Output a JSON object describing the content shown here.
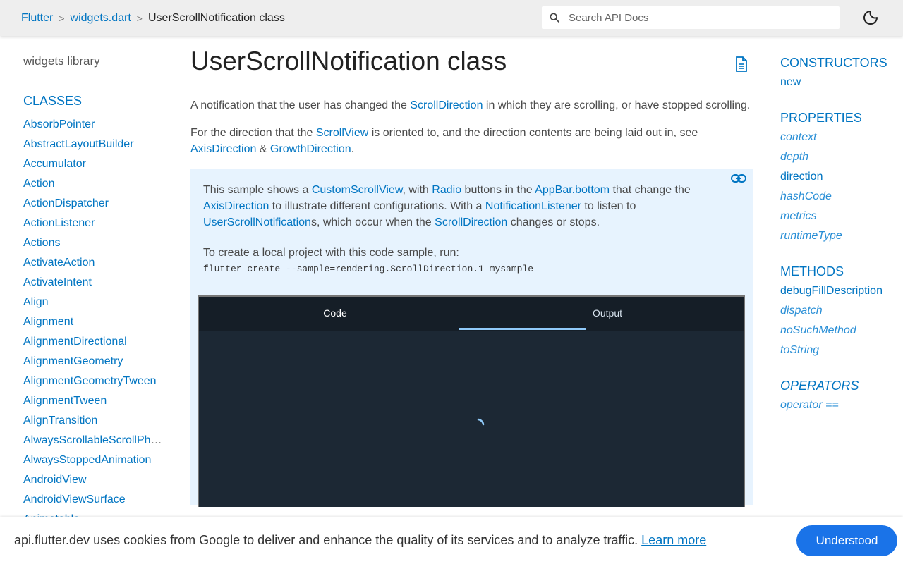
{
  "header": {
    "breadcrumb": [
      {
        "label": "Flutter"
      },
      {
        "label": "widgets.dart"
      },
      {
        "label": "UserScrollNotification class"
      }
    ],
    "search_placeholder": "Search API Docs",
    "icons": {
      "search": "search-icon",
      "theme": "moon-icon"
    }
  },
  "left_nav": {
    "library": "widgets library",
    "section": "CLASSES",
    "items": [
      "AbsorbPointer",
      "AbstractLayoutBuilder",
      "Accumulator",
      "Action",
      "ActionDispatcher",
      "ActionListener",
      "Actions",
      "ActivateAction",
      "ActivateIntent",
      "Align",
      "Alignment",
      "AlignmentDirectional",
      "AlignmentGeometry",
      "AlignmentGeometryTween",
      "AlignmentTween",
      "AlignTransition",
      "AlwaysScrollableScrollPhysics",
      "AlwaysStoppedAnimation",
      "AndroidView",
      "AndroidViewSurface",
      "Animatable"
    ]
  },
  "main": {
    "title": "UserScrollNotification class",
    "p1": {
      "t1": "A notification that the user has changed the ",
      "l1": "ScrollDirection",
      "t2": " in which they are scrolling, or have stopped scrolling."
    },
    "p2": {
      "t1": "For the direction that the ",
      "l1": "ScrollView",
      "t2": " is oriented to, and the direction contents are being laid out in, see ",
      "l2": "AxisDirection",
      "t3": " & ",
      "l3": "GrowthDirection",
      "t4": "."
    },
    "sample": {
      "t1": "This sample shows a ",
      "l1": "CustomScrollView",
      "t2": ", with ",
      "l2": "Radio",
      "t3": " buttons in the ",
      "l3": "AppBar.bottom",
      "t4": " that change the ",
      "l4": "AxisDirection",
      "t5": " to illustrate different configurations. With a ",
      "l5": "NotificationListener",
      "t6": " to listen to ",
      "l6": "UserScrollNotification",
      "t7": "s, which occur when the ",
      "l7": "ScrollDirection",
      "t8": " changes or stops.",
      "run_label": "To create a local project with this code sample, run:",
      "command": "flutter create --sample=rendering.ScrollDirection.1 mysample"
    },
    "dartpad": {
      "tab_code": "Code",
      "tab_output": "Output",
      "active_tab": "Output"
    }
  },
  "right_nav": {
    "constructors": {
      "title": "CONSTRUCTORS",
      "items": [
        {
          "label": "new",
          "italic": false
        }
      ]
    },
    "properties": {
      "title": "PROPERTIES",
      "items": [
        {
          "label": "context",
          "italic": true
        },
        {
          "label": "depth",
          "italic": true
        },
        {
          "label": "direction",
          "italic": false
        },
        {
          "label": "hashCode",
          "italic": true
        },
        {
          "label": "metrics",
          "italic": true
        },
        {
          "label": "runtimeType",
          "italic": true
        }
      ]
    },
    "methods": {
      "title": "METHODS",
      "items": [
        {
          "label": "debugFillDescription",
          "italic": false
        },
        {
          "label": "dispatch",
          "italic": true
        },
        {
          "label": "noSuchMethod",
          "italic": true
        },
        {
          "label": "toString",
          "italic": true
        }
      ]
    },
    "operators": {
      "title": "OPERATORS",
      "items": [
        {
          "label": "operator ==",
          "italic": true
        }
      ]
    }
  },
  "cookie": {
    "message": "api.flutter.dev uses cookies from Google to deliver and enhance the quality of its services and to analyze traffic. ",
    "link": "Learn more",
    "button": "Understood"
  },
  "colors": {
    "link": "#0175c2",
    "sample_bg": "#e7f3fe",
    "button": "#1a73e8",
    "header_bg": "#eeeeee"
  }
}
